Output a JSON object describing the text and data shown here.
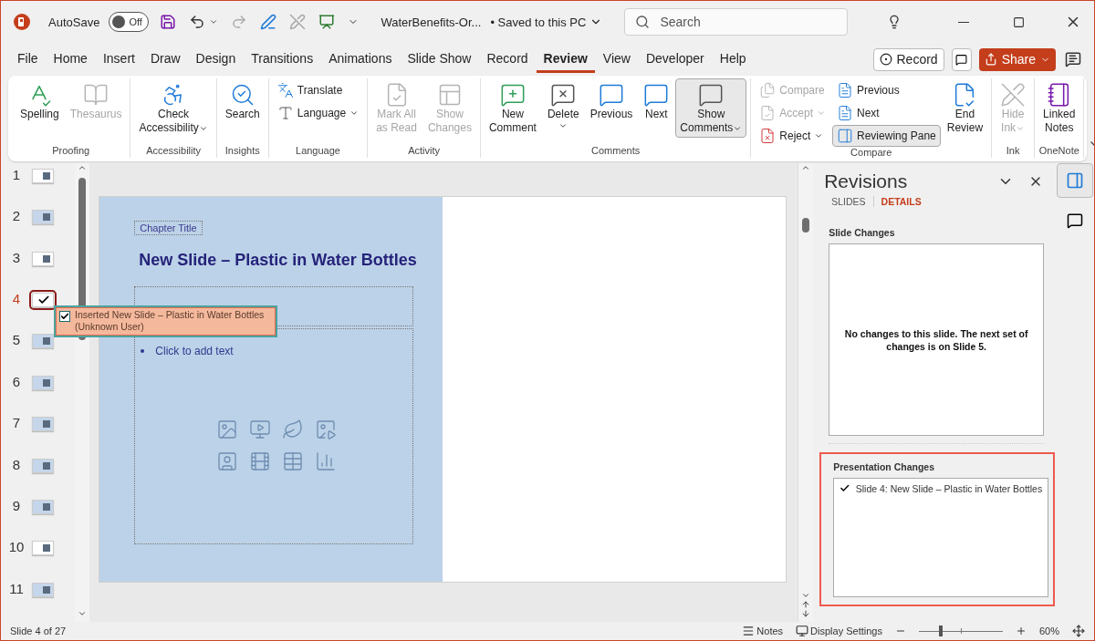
{
  "title_bar": {
    "autosave_label": "AutoSave",
    "autosave_on": false,
    "autosave_state": "Off",
    "filename": "WaterBenefits-Or...",
    "save_status": "• Saved to this PC",
    "search_placeholder": "Search"
  },
  "menu_tabs": [
    {
      "label": "File",
      "selected": false
    },
    {
      "label": "Home",
      "selected": false
    },
    {
      "label": "Insert",
      "selected": false
    },
    {
      "label": "Draw",
      "selected": false
    },
    {
      "label": "Design",
      "selected": false
    },
    {
      "label": "Transitions",
      "selected": false
    },
    {
      "label": "Animations",
      "selected": false
    },
    {
      "label": "Slide Show",
      "selected": false
    },
    {
      "label": "Record",
      "selected": false
    },
    {
      "label": "Review",
      "selected": true
    },
    {
      "label": "View",
      "selected": false
    },
    {
      "label": "Developer",
      "selected": false
    },
    {
      "label": "Help",
      "selected": false
    }
  ],
  "header_buttons": {
    "record": "Record",
    "share": "Share"
  },
  "ribbon_groups": [
    {
      "label": "Proofing",
      "items": [
        {
          "kind": "large",
          "label": "Spelling",
          "disabled": false
        },
        {
          "kind": "large",
          "label": "Thesaurus",
          "disabled": true
        }
      ]
    },
    {
      "label": "Accessibility",
      "items": [
        {
          "kind": "large",
          "label": "Check\nAccessibility",
          "disabled": false,
          "dropdown": true
        }
      ]
    },
    {
      "label": "Insights",
      "items": [
        {
          "kind": "large",
          "label": "Search",
          "disabled": false
        }
      ]
    },
    {
      "label": "Language",
      "items": [
        {
          "kind": "stack",
          "items": [
            {
              "label": "Translate",
              "disabled": false
            },
            {
              "label": "Language",
              "disabled": false,
              "dropdown": true
            }
          ]
        }
      ]
    },
    {
      "label": "Activity",
      "items": [
        {
          "kind": "large",
          "label": "Mark All\nas Read",
          "disabled": true
        },
        {
          "kind": "large",
          "label": "Show\nChanges",
          "disabled": true
        }
      ]
    },
    {
      "label": "Comments",
      "items": [
        {
          "kind": "large",
          "label": "New\nComment",
          "disabled": false
        },
        {
          "kind": "large",
          "label": "Delete",
          "disabled": false,
          "dropdown": true
        },
        {
          "kind": "large",
          "label": "Previous",
          "disabled": false
        },
        {
          "kind": "large",
          "label": "Next",
          "disabled": false
        },
        {
          "kind": "large",
          "label": "Show\nComments",
          "disabled": false,
          "dropdown": true,
          "selected": true
        }
      ]
    },
    {
      "label": "Compare",
      "items": [
        {
          "kind": "stack",
          "items": [
            {
              "label": "Compare",
              "disabled": true
            },
            {
              "label": "Accept",
              "disabled": true,
              "dropdown": true
            },
            {
              "label": "Reject",
              "disabled": false,
              "dropdown": true
            }
          ]
        },
        {
          "kind": "stack",
          "items": [
            {
              "label": "Previous",
              "disabled": false
            },
            {
              "label": "Next",
              "disabled": false
            },
            {
              "label": "Reviewing Pane",
              "disabled": false,
              "selected": true
            }
          ]
        },
        {
          "kind": "large",
          "label": "End\nReview",
          "disabled": false
        }
      ]
    },
    {
      "label": "Ink",
      "items": [
        {
          "kind": "large",
          "label": "Hide\nInk",
          "disabled": true,
          "dropdown": true
        }
      ]
    },
    {
      "label": "OneNote",
      "items": [
        {
          "kind": "large",
          "label": "Linked\nNotes",
          "disabled": false
        }
      ]
    }
  ],
  "slides": [
    {
      "number": "1",
      "selected": false,
      "has_revision": false
    },
    {
      "number": "2",
      "selected": false,
      "has_revision": false
    },
    {
      "number": "3",
      "selected": false,
      "has_revision": false
    },
    {
      "number": "4",
      "selected": true,
      "has_revision": true
    },
    {
      "number": "5",
      "selected": false,
      "has_revision": false
    },
    {
      "number": "6",
      "selected": false,
      "has_revision": false
    },
    {
      "number": "7",
      "selected": false,
      "has_revision": false
    },
    {
      "number": "8",
      "selected": false,
      "has_revision": false
    },
    {
      "number": "9",
      "selected": false,
      "has_revision": false
    },
    {
      "number": "10",
      "selected": false,
      "has_revision": false
    },
    {
      "number": "11",
      "selected": false,
      "has_revision": false
    }
  ],
  "revision_tooltip": {
    "checked": true,
    "text": "Inserted New Slide – Plastic in Water Bottles",
    "user": "(Unknown User)"
  },
  "slide": {
    "chapter": "Chapter Title",
    "title": "New Slide – Plastic in Water Bottles",
    "body_placeholder": "Click to add text"
  },
  "revisions_pane": {
    "title": "Revisions",
    "tabs": [
      {
        "label": "SLIDES",
        "selected": false
      },
      {
        "label": "DETAILS",
        "selected": true
      }
    ],
    "slide_changes_heading": "Slide Changes",
    "slide_changes_message": "No changes to this slide.  The next set of changes is on Slide 5.",
    "presentation_changes_heading": "Presentation Changes",
    "presentation_changes": [
      {
        "label": "Slide 4: New Slide – Plastic in Water Bottles",
        "checked": true
      }
    ]
  },
  "status_bar": {
    "slide_info": "Slide 4 of 27",
    "notes": "Notes",
    "display_settings": "Display Settings",
    "zoom_slider": {
      "level": 0.26
    },
    "zoom": "60%"
  }
}
